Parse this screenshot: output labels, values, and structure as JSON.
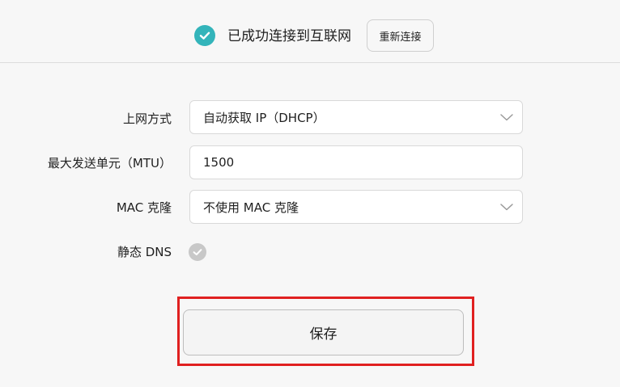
{
  "status": {
    "icon": "check-circle-icon",
    "accent_color": "#33b4ba",
    "text": "已成功连接到互联网",
    "reconnect_label": "重新连接"
  },
  "form": {
    "connection_type": {
      "label": "上网方式",
      "value": "自动获取 IP（DHCP）"
    },
    "mtu": {
      "label": "最大发送单元（MTU）",
      "value": "1500"
    },
    "mac_clone": {
      "label": "MAC 克隆",
      "value": "不使用 MAC 克隆"
    },
    "static_dns": {
      "label": "静态 DNS",
      "checked": false
    }
  },
  "save_label": "保存",
  "highlight_color": "#e02020"
}
